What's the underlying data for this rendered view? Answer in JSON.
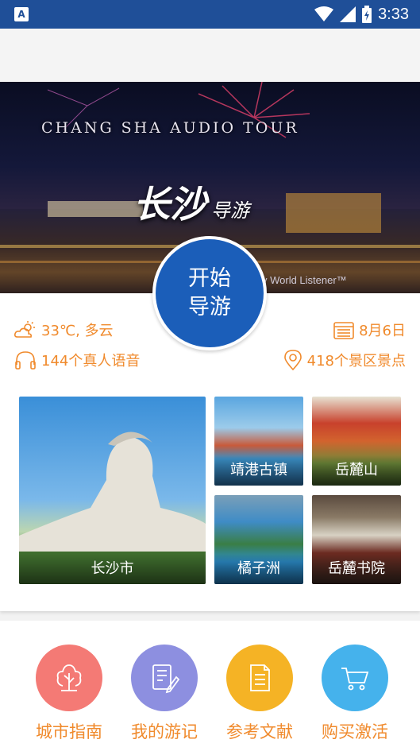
{
  "status_bar": {
    "time": "3:33"
  },
  "banner": {
    "title_en": "CHANG SHA AUDIO TOUR",
    "title_cn": "长沙",
    "title_cn_small": "导游",
    "credit": "y World Listener™"
  },
  "start_button": {
    "line1": "开始",
    "line2": "导游"
  },
  "info": {
    "weather": "33℃, 多云",
    "date": "8月6日",
    "voices": "144个真人语音",
    "spots": "418个景区景点"
  },
  "tiles": [
    {
      "label": "长沙市"
    },
    {
      "label": "靖港古镇"
    },
    {
      "label": "岳麓山"
    },
    {
      "label": "橘子洲"
    },
    {
      "label": "岳麓书院"
    }
  ],
  "nav": [
    {
      "label": "城市指南",
      "icon": "tree-icon",
      "color": "#f47a75"
    },
    {
      "label": "我的游记",
      "icon": "notebook-pen-icon",
      "color": "#8d8fe0"
    },
    {
      "label": "参考文献",
      "icon": "document-icon",
      "color": "#f5b325"
    },
    {
      "label": "购买激活",
      "icon": "cart-icon",
      "color": "#45b2ec"
    }
  ],
  "colors": {
    "accent": "#f08a2c",
    "primary": "#1b5eb9",
    "status_bar": "#1f4f98"
  }
}
